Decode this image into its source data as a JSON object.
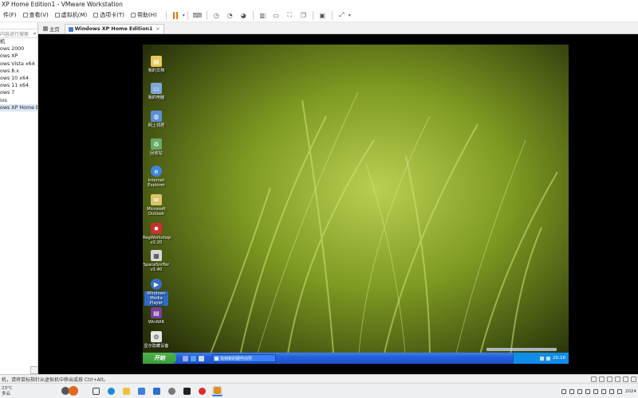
{
  "window": {
    "title": "XP Home Edition1 - VMware Workstation"
  },
  "menu": [
    {
      "label": "件(F)"
    },
    {
      "label": "查看(V)"
    },
    {
      "label": "虚拟机(M)"
    },
    {
      "label": "选项卡(T)"
    },
    {
      "label": "帮助(H)"
    }
  ],
  "library": {
    "search_placeholder": "内容进行搜索",
    "items": [
      {
        "label": "机"
      },
      {
        "label": "ows 2000"
      },
      {
        "label": "ows XP"
      },
      {
        "label": "ows Vista x64"
      },
      {
        "label": "ows 8.x"
      },
      {
        "label": "ows 10 x64"
      },
      {
        "label": "ows 11 x64"
      },
      {
        "label": "ows 7"
      },
      {
        "label": "ios"
      },
      {
        "label": "ows XP Home Ed"
      }
    ]
  },
  "tabs": [
    {
      "label": "主页"
    },
    {
      "label": "Windows XP Home Edition1"
    }
  ],
  "guest": {
    "desktop_icons": [
      {
        "label": "我的文档",
        "name": "my-documents"
      },
      {
        "label": "我的电脑",
        "name": "my-computer"
      },
      {
        "label": "网上邻居",
        "name": "network-places"
      },
      {
        "label": "回收站",
        "name": "recycle-bin"
      },
      {
        "label": "Internet Explorer",
        "name": "internet-explorer"
      },
      {
        "label": "Microsoft Outlook",
        "name": "microsoft-outlook"
      },
      {
        "label": "RegWorkshop v2.20",
        "name": "regworkshop"
      },
      {
        "label": "SpaceSniffer v1.40",
        "name": "spacesniffer"
      },
      {
        "label": "Windows Media Player",
        "name": "windows-media-player"
      },
      {
        "label": "WinRAR",
        "name": "winrar"
      },
      {
        "label": "显示隐藏设备",
        "name": "show-hidden-devices"
      }
    ],
    "taskbar": {
      "start_label": "开始",
      "task_label": "找到新的硬件向导",
      "clock": "20:18"
    }
  },
  "status": {
    "message": "机，请将鼠标指针从虚拟机中移出或按 Ctrl+Alt。"
  },
  "host_taskbar": {
    "weather_top": "23°C",
    "weather_bottom": "多云",
    "clock": "2024"
  }
}
